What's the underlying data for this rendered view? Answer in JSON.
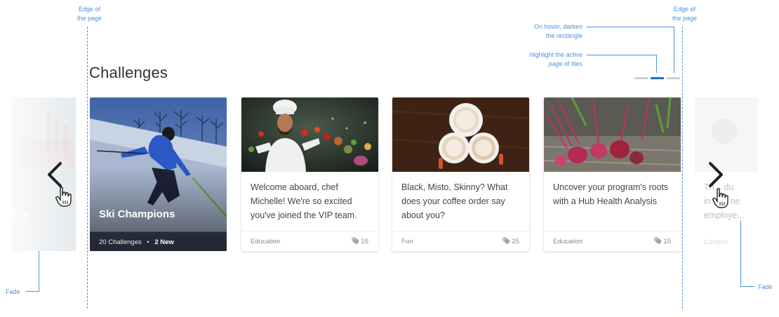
{
  "annotations": {
    "edge_left": [
      "Edge of",
      "the page"
    ],
    "edge_right": [
      "Edge of",
      "the page"
    ],
    "hover_note": [
      "On hover, darken",
      "the rectangle"
    ],
    "active_note_line1": "Highlight the active",
    "active_note_italic": "page",
    "active_note_rest": " of tiles",
    "fade_left": "Fade",
    "fade_right": "Fade"
  },
  "section": {
    "title": "Challenges"
  },
  "pager": {
    "pages": 3,
    "active_index": 1
  },
  "left_partial": {
    "title_fragment": "aily"
  },
  "featured": {
    "title": "Ski Champions",
    "challenges_label": "20 Challenges",
    "separator": "•",
    "new_label": "2 New"
  },
  "cards": [
    {
      "title": "Welcome aboard, chef Michelle! We're so excited you've joined the VIP team.",
      "category": "Education",
      "count": "15",
      "image": "chef-photo"
    },
    {
      "title": "Black, Misto, Skinny? What does your coffee order say about you?",
      "category": "Fun",
      "count": "25",
      "image": "coffee-cups-photo"
    },
    {
      "title": "Uncover your program's roots with a Hub Health Analysis",
      "category": "Education",
      "count": "15",
      "image": "beets-photo"
    }
  ],
  "right_partial": {
    "line1": "Th... du",
    "line2": "in... of ne",
    "line3": "employe...",
    "category": "Content"
  },
  "icons": {
    "prev": "chevron-left-icon",
    "next": "chevron-right-icon",
    "cursor": "hand-pointer-icon",
    "comments": "comment-icon"
  },
  "colors": {
    "accent": "#1f6fd1",
    "annotation": "#4a90e2",
    "pager_inactive": "#c9ced4"
  }
}
